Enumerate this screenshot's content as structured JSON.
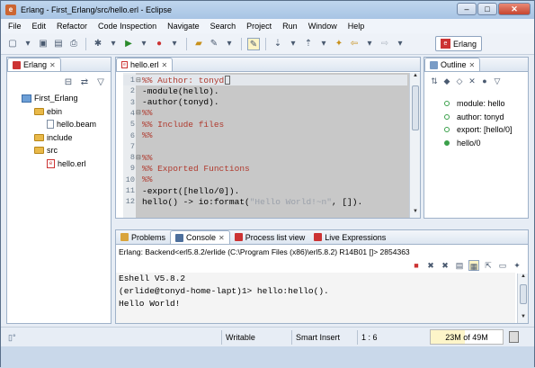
{
  "window": {
    "title": "Erlang - First_Erlang/src/hello.erl - Eclipse",
    "minimize": "–",
    "maximize": "□",
    "close": "✕"
  },
  "menu": [
    "File",
    "Edit",
    "Refactor",
    "Code Inspection",
    "Navigate",
    "Search",
    "Project",
    "Run",
    "Window",
    "Help"
  ],
  "perspective": {
    "label": "Erlang",
    "icon": "erlang-perspective-icon"
  },
  "explorer": {
    "tab": "Erlang",
    "items": [
      {
        "label": "First_Erlang",
        "type": "project",
        "indent": 1
      },
      {
        "label": "ebin",
        "type": "folder",
        "indent": 2
      },
      {
        "label": "hello.beam",
        "type": "file",
        "indent": 3
      },
      {
        "label": "include",
        "type": "folder",
        "indent": 2
      },
      {
        "label": "src",
        "type": "folder",
        "indent": 2
      },
      {
        "label": "hello.erl",
        "type": "erl",
        "indent": 3
      }
    ]
  },
  "editor": {
    "tab": "hello.erl",
    "lines": [
      {
        "n": "1",
        "text": "%% Author: tonyd",
        "kind": "comment",
        "fold": "⊟"
      },
      {
        "n": "2",
        "text": "-module(hello).",
        "kind": "code",
        "fold": ""
      },
      {
        "n": "3",
        "text": "-author(tonyd).",
        "kind": "code",
        "fold": ""
      },
      {
        "n": "4",
        "text": "%%",
        "kind": "comment",
        "fold": "⊟"
      },
      {
        "n": "5",
        "text": "%% Include files",
        "kind": "comment",
        "fold": ""
      },
      {
        "n": "6",
        "text": "%%",
        "kind": "comment",
        "fold": ""
      },
      {
        "n": "7",
        "text": "",
        "kind": "code",
        "fold": ""
      },
      {
        "n": "8",
        "text": "%%",
        "kind": "comment",
        "fold": "⊟"
      },
      {
        "n": "9",
        "text": "%% Exported Functions",
        "kind": "comment",
        "fold": ""
      },
      {
        "n": "10",
        "text": "%%",
        "kind": "comment",
        "fold": ""
      },
      {
        "n": "11",
        "text": "-export([hello/0]).",
        "kind": "code",
        "fold": ""
      },
      {
        "n": "12",
        "text_pre": "hello() -> io:format(",
        "text_str": "\"Hello World!~n\"",
        "text_post": ", []).",
        "kind": "mixed",
        "fold": ""
      }
    ]
  },
  "outline": {
    "tab": "Outline",
    "items": [
      {
        "label": "module: hello",
        "filled": false
      },
      {
        "label": "author: tonyd",
        "filled": false
      },
      {
        "label": "export: [hello/0]",
        "filled": false
      },
      {
        "label": "hello/0",
        "filled": true
      }
    ]
  },
  "bottom": {
    "tabs": [
      "Problems",
      "Console",
      "Process list view",
      "Live Expressions"
    ],
    "console_header": "Erlang: Backend<erl5.8.2/erlide (C:\\Program Files (x86)\\erl5.8.2) R14B01 []> 2854363",
    "lines": [
      "Eshell V5.8.2",
      "(erlide@tonyd-home-lapt)1> hello:hello().",
      "Hello World!"
    ]
  },
  "status": {
    "writable": "Writable",
    "insert": "Smart Insert",
    "position": "1 : 6",
    "heap": "23M of 49M",
    "heap_used_fraction": 0.47
  }
}
